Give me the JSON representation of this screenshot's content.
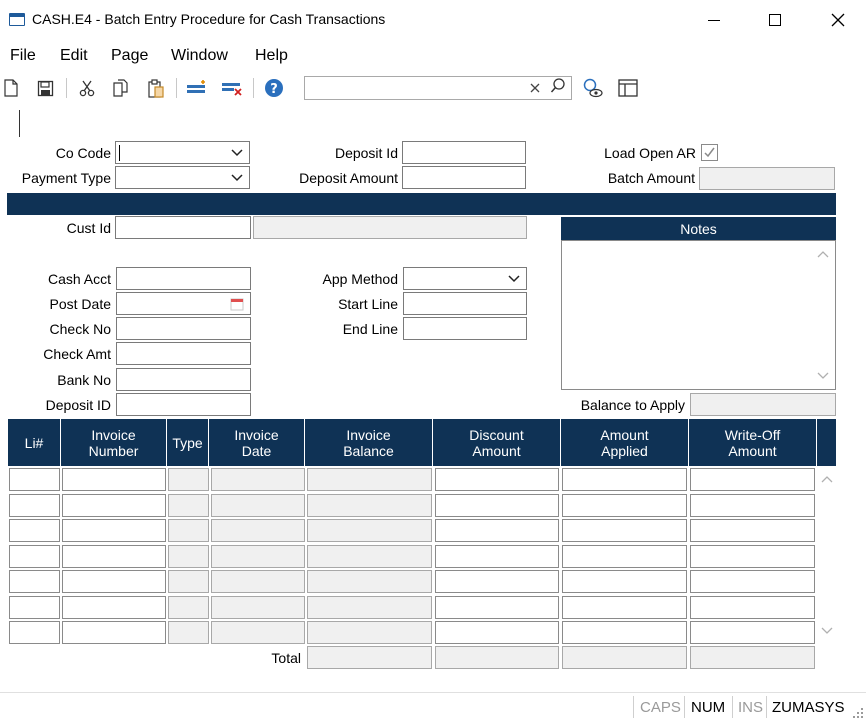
{
  "window": {
    "title": "CASH.E4 - Batch Entry Procedure for Cash Transactions"
  },
  "menu": [
    "File",
    "Edit",
    "Page",
    "Window",
    "Help"
  ],
  "toolbar": {
    "search_value": "",
    "icons": [
      "new-icon",
      "save-icon",
      "cut-icon",
      "copy-icon",
      "paste-icon",
      "insert-row-icon",
      "delete-row-icon",
      "help-icon",
      "search-clear-icon",
      "search-icon",
      "preview-icon",
      "layout-icon"
    ]
  },
  "form": {
    "co_code": {
      "label": "Co Code",
      "value": ""
    },
    "payment_type": {
      "label": "Payment Type",
      "value": ""
    },
    "deposit_id": {
      "label": "Deposit Id",
      "value": ""
    },
    "deposit_amount": {
      "label": "Deposit Amount",
      "value": ""
    },
    "load_open_ar": {
      "label": "Load Open AR",
      "checked": true
    },
    "batch_amount": {
      "label": "Batch Amount",
      "value": ""
    },
    "cust_id": {
      "label": "Cust Id",
      "value": "",
      "name_value": ""
    },
    "cash_acct": {
      "label": "Cash Acct",
      "value": ""
    },
    "post_date": {
      "label": "Post Date",
      "value": ""
    },
    "check_no": {
      "label": "Check No",
      "value": ""
    },
    "check_amt": {
      "label": "Check Amt",
      "value": ""
    },
    "bank_no": {
      "label": "Bank No",
      "value": ""
    },
    "deposit_id_2": {
      "label": "Deposit ID",
      "value": ""
    },
    "app_method": {
      "label": "App Method",
      "value": ""
    },
    "start_line": {
      "label": "Start Line",
      "value": ""
    },
    "end_line": {
      "label": "End Line",
      "value": ""
    },
    "notes": {
      "label": "Notes",
      "value": ""
    },
    "balance_to_apply": {
      "label": "Balance to Apply",
      "value": ""
    }
  },
  "grid": {
    "headers": [
      "Li#",
      "Invoice\nNumber",
      "Type",
      "Invoice\nDate",
      "Invoice\nBalance",
      "Discount\nAmount",
      "Amount\nApplied",
      "Write-Off\nAmount"
    ],
    "row_count": 7,
    "total_label": "Total"
  },
  "status": {
    "caps": "CAPS",
    "num": "NUM",
    "ins": "INS",
    "company": "ZUMASYS"
  },
  "colors": {
    "header_bg": "#0f3255",
    "readonly_bg": "#f0f0f0"
  }
}
